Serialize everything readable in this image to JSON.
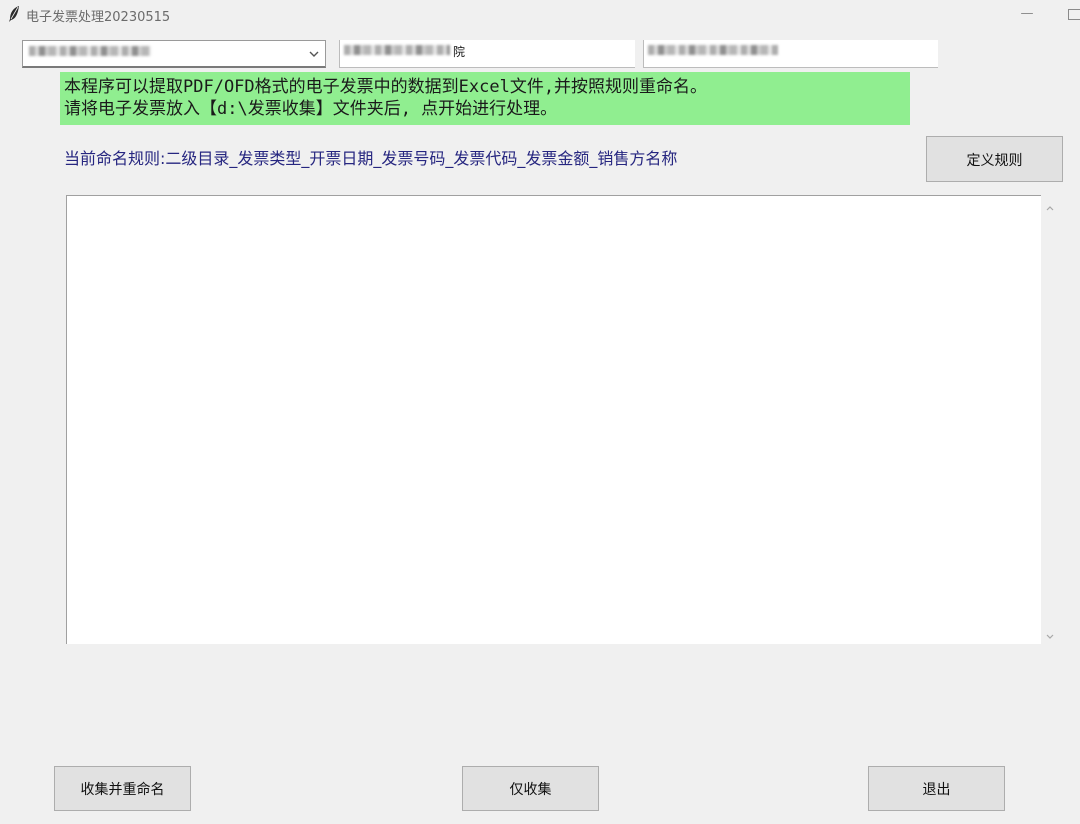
{
  "window": {
    "title": "电子发票处理20230515",
    "minimize_symbol": "—"
  },
  "inputs": {
    "combo_value": "",
    "entry_2_visible_suffix": "院",
    "entry_3_value": ""
  },
  "info_banner": {
    "line1": "本程序可以提取PDF/OFD格式的电子发票中的数据到Excel文件,并按照规则重命名。",
    "line2": "请将电子发票放入【d:\\发票收集】文件夹后, 点开始进行处理。"
  },
  "naming_rule": {
    "text": "当前命名规则:二级目录_发票类型_开票日期_发票号码_发票代码_发票金额_销售方名称"
  },
  "buttons": {
    "define_rules": "定义规则",
    "collect_and_rename": "收集并重命名",
    "collect_only": "仅收集",
    "exit": "退出"
  },
  "output": {
    "text": ""
  },
  "colors": {
    "window_bg": "#f0f0f0",
    "banner_bg": "#90ee90",
    "rule_text": "#262680",
    "button_bg": "#e1e1e1"
  },
  "icons": {
    "app": "feather-icon",
    "combo_toggle": "chevron-down-icon",
    "scroll_up": "chevron-up-icon",
    "scroll_down": "chevron-down-icon"
  }
}
